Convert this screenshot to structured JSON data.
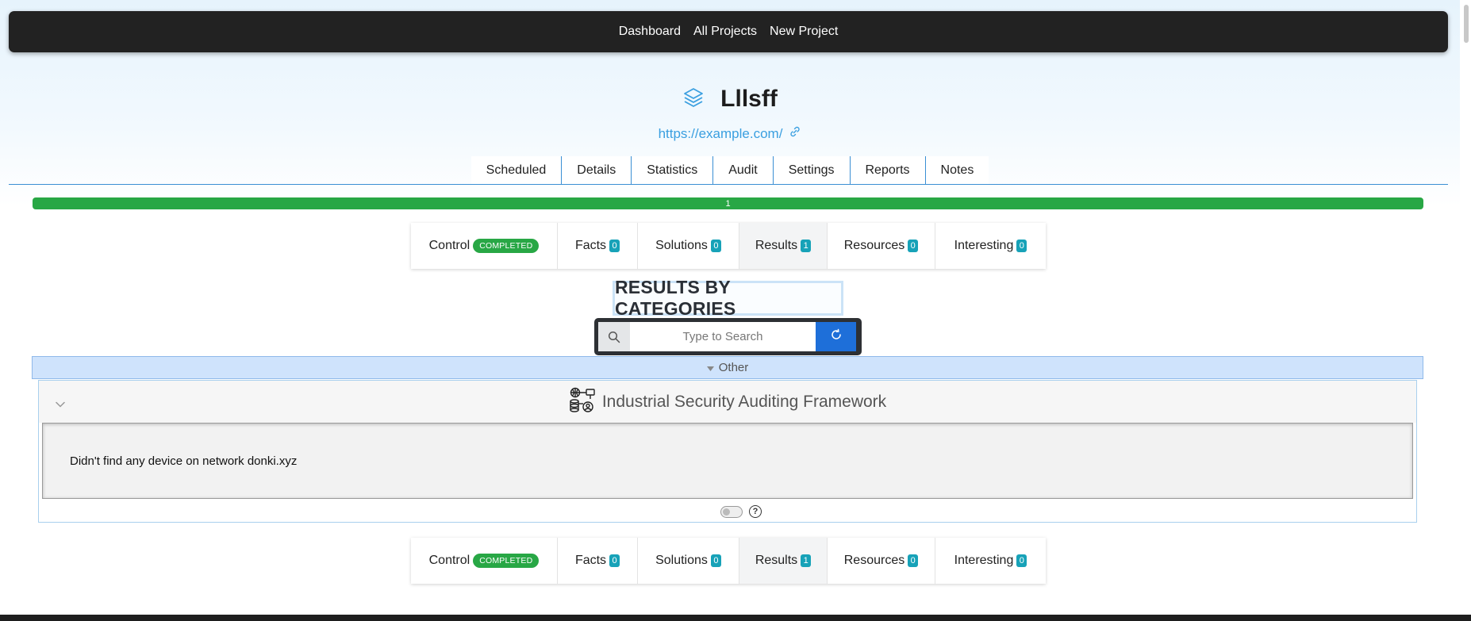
{
  "nav": {
    "links": [
      "Dashboard",
      "All Projects",
      "New Project"
    ]
  },
  "project": {
    "name": "Lllsff",
    "url": "https://example.com/"
  },
  "main_tabs": [
    "Scheduled",
    "Details",
    "Statistics",
    "Audit",
    "Settings",
    "Reports",
    "Notes"
  ],
  "progress": {
    "label": "1",
    "fraction": 1.0,
    "color": "#28a745"
  },
  "result_tabs": {
    "control": "Control",
    "control_status": "COMPLETED",
    "facts": "Facts",
    "facts_count": "0",
    "solutions": "Solutions",
    "solutions_count": "0",
    "results": "Results",
    "results_count": "1",
    "resources": "Resources",
    "resources_count": "0",
    "interesting": "Interesting",
    "interesting_count": "0",
    "active": "Results"
  },
  "section": {
    "heading": "RESULTS BY CATEGORIES"
  },
  "search": {
    "placeholder": "Type to Search"
  },
  "category": {
    "name": "Other"
  },
  "tool": {
    "name": "Industrial Security Auditing Framework",
    "result_text": "Didn't find any device on network donki.xyz"
  },
  "icons": [
    "layers-icon",
    "link-icon",
    "search-icon",
    "refresh-icon",
    "caret-down-icon",
    "chevron-down-icon",
    "network-tool-icon",
    "help-icon"
  ],
  "colors": {
    "accent": "#3a9fe0",
    "success": "#28a745",
    "info": "#17a2b8",
    "primary_button": "#1e6fd9",
    "navbar": "#222222"
  }
}
